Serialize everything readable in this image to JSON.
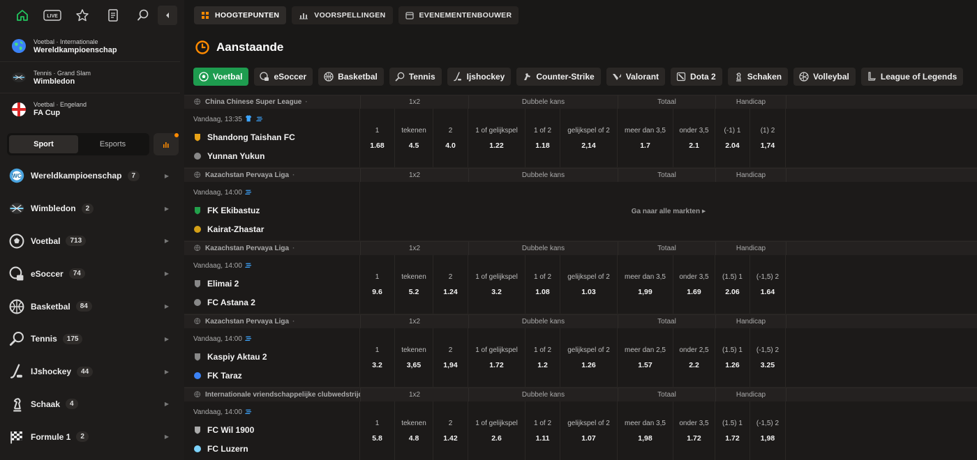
{
  "sidebar": {
    "featured": [
      {
        "meta": "Voetbal · Internationale",
        "name": "Wereldkampioenschap",
        "icon": "globe-icon"
      },
      {
        "meta": "Tennis · Grand Slam",
        "name": "Wimbledon",
        "icon": "wimbledon-logo"
      },
      {
        "meta": "Voetbal · Engeland",
        "name": "FA Cup",
        "icon": "england-flag"
      }
    ],
    "switch": {
      "sport": "Sport",
      "esports": "Esports"
    },
    "sports": [
      {
        "name": "Wereldkampioenschap",
        "count": "7",
        "icon": "worldcup-icon"
      },
      {
        "name": "Wimbledon",
        "count": "2",
        "icon": "wimbledon-icon"
      },
      {
        "name": "Voetbal",
        "count": "713",
        "icon": "soccer-ball-icon"
      },
      {
        "name": "eSoccer",
        "count": "74",
        "icon": "esoccer-icon"
      },
      {
        "name": "Basketbal",
        "count": "84",
        "icon": "basketball-icon"
      },
      {
        "name": "Tennis",
        "count": "175",
        "icon": "tennis-icon"
      },
      {
        "name": "IJshockey",
        "count": "44",
        "icon": "hockey-icon"
      },
      {
        "name": "Schaak",
        "count": "4",
        "icon": "chess-icon"
      },
      {
        "name": "Formule 1",
        "count": "2",
        "icon": "checkered-flag-icon"
      }
    ]
  },
  "topnav": [
    {
      "label": "HOOGTEPUNTEN",
      "icon": "grid-icon",
      "active": true
    },
    {
      "label": "VOORSPELLINGEN",
      "icon": "chart-icon",
      "active": false
    },
    {
      "label": "EVENEMENTENBOUWER",
      "icon": "calendar-icon",
      "active": false
    }
  ],
  "heading": "Aanstaande",
  "chips": [
    {
      "label": "Voetbal",
      "active": true
    },
    {
      "label": "eSoccer"
    },
    {
      "label": "Basketbal"
    },
    {
      "label": "Tennis"
    },
    {
      "label": "Ijshockey"
    },
    {
      "label": "Counter-Strike"
    },
    {
      "label": "Valorant"
    },
    {
      "label": "Dota 2"
    },
    {
      "label": "Schaken"
    },
    {
      "label": "Volleybal"
    },
    {
      "label": "League of Legends"
    }
  ],
  "groups": {
    "g1": "1x2",
    "g2": "Dubbele kans",
    "g3": "Totaal",
    "g4": "Handicap"
  },
  "colors": {
    "accent": "#1e9c4f",
    "orange": "#ff8a00",
    "blue": "#3ea6ff"
  },
  "matches": [
    {
      "league": "China Chinese Super League",
      "time": "Vandaag, 13:35",
      "home": "Shandong Taishan FC",
      "away": "Yunnan Yukun",
      "odds": [
        {
          "l": "1",
          "v": "1.68"
        },
        {
          "l": "tekenen",
          "v": "4.5"
        },
        {
          "l": "2",
          "v": "4.0"
        },
        {
          "l": "1 of gelijkspel",
          "v": "1.22"
        },
        {
          "l": "1 of 2",
          "v": "1.18"
        },
        {
          "l": "gelijkspel of 2",
          "v": "2,14"
        },
        {
          "l": "meer dan 3,5",
          "v": "1.7"
        },
        {
          "l": "onder 3,5",
          "v": "2.1"
        },
        {
          "l": "(-1)  1",
          "v": "2.04"
        },
        {
          "l": "(1)  2",
          "v": "1,74"
        }
      ]
    },
    {
      "league": "Kazachstan Pervaya Liga",
      "time": "Vandaag, 14:00",
      "home": "FK Ekibastuz",
      "away": "Kairat-Zhastar",
      "allmarkets": "Ga naar alle markten"
    },
    {
      "league": "Kazachstan Pervaya Liga",
      "time": "Vandaag, 14:00",
      "home": "Elimai 2",
      "away": "FC Astana 2",
      "odds": [
        {
          "l": "1",
          "v": "9.6"
        },
        {
          "l": "tekenen",
          "v": "5.2"
        },
        {
          "l": "2",
          "v": "1.24"
        },
        {
          "l": "1 of gelijkspel",
          "v": "3.2"
        },
        {
          "l": "1 of 2",
          "v": "1.08"
        },
        {
          "l": "gelijkspel of 2",
          "v": "1.03"
        },
        {
          "l": "meer dan 3,5",
          "v": "1,99"
        },
        {
          "l": "onder 3,5",
          "v": "1.69"
        },
        {
          "l": "(1.5)  1",
          "v": "2.06"
        },
        {
          "l": "(-1,5)  2",
          "v": "1.64"
        }
      ]
    },
    {
      "league": "Kazachstan Pervaya Liga",
      "time": "Vandaag, 14:00",
      "home": "Kaspiy Aktau 2",
      "away": "FK Taraz",
      "odds": [
        {
          "l": "1",
          "v": "3.2"
        },
        {
          "l": "tekenen",
          "v": "3,65"
        },
        {
          "l": "2",
          "v": "1,94"
        },
        {
          "l": "1 of gelijkspel",
          "v": "1.72"
        },
        {
          "l": "1 of 2",
          "v": "1.2"
        },
        {
          "l": "gelijkspel of 2",
          "v": "1.26"
        },
        {
          "l": "meer dan 2,5",
          "v": "1.57"
        },
        {
          "l": "onder 2,5",
          "v": "2.2"
        },
        {
          "l": "(1.5)  1",
          "v": "1.26"
        },
        {
          "l": "(-1,5)  2",
          "v": "3.25"
        }
      ]
    },
    {
      "league": "Internationale vriendschappelijke clubwedstrijden",
      "time": "Vandaag, 14:00",
      "home": "FC Wil 1900",
      "away": "FC Luzern",
      "odds": [
        {
          "l": "1",
          "v": "5.8"
        },
        {
          "l": "tekenen",
          "v": "4.8"
        },
        {
          "l": "2",
          "v": "1.42"
        },
        {
          "l": "1 of gelijkspel",
          "v": "2.6"
        },
        {
          "l": "1 of 2",
          "v": "1.11"
        },
        {
          "l": "gelijkspel of 2",
          "v": "1.07"
        },
        {
          "l": "meer dan 3,5",
          "v": "1,98"
        },
        {
          "l": "onder 3,5",
          "v": "1.72"
        },
        {
          "l": "(1.5)  1",
          "v": "1.72"
        },
        {
          "l": "(-1,5)  2",
          "v": "1,98"
        }
      ]
    }
  ]
}
